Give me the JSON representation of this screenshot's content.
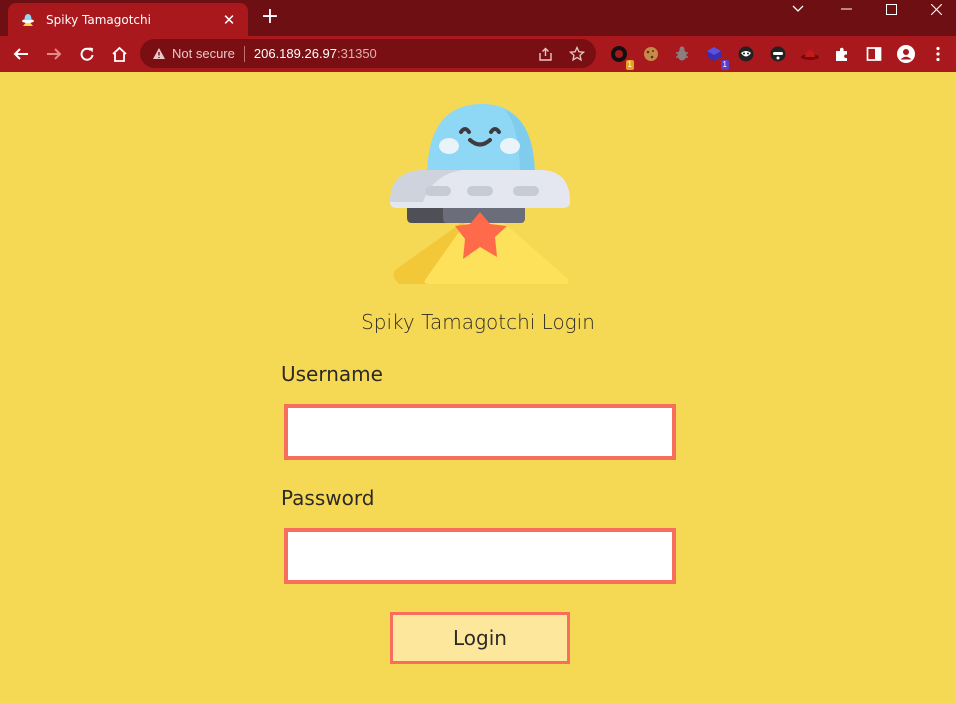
{
  "browser": {
    "tab_title": "Spiky Tamagotchi",
    "tab_close": "✕",
    "new_tab": "+",
    "security_label": "Not secure",
    "url_host": "206.189.26.97",
    "url_port": ":31350",
    "extension_badges": [
      "1",
      "1"
    ]
  },
  "login": {
    "title": "Spiky Tamagotchi Login",
    "username_label": "Username",
    "username_value": "",
    "password_label": "Password",
    "password_value": "",
    "submit_label": "Login"
  },
  "colors": {
    "page_background": "#f5d853",
    "chrome_tabstrip": "#6e1013",
    "chrome_toolbar": "#a8181d",
    "field_border": "#f76e5c",
    "button_background": "#fde79d"
  }
}
